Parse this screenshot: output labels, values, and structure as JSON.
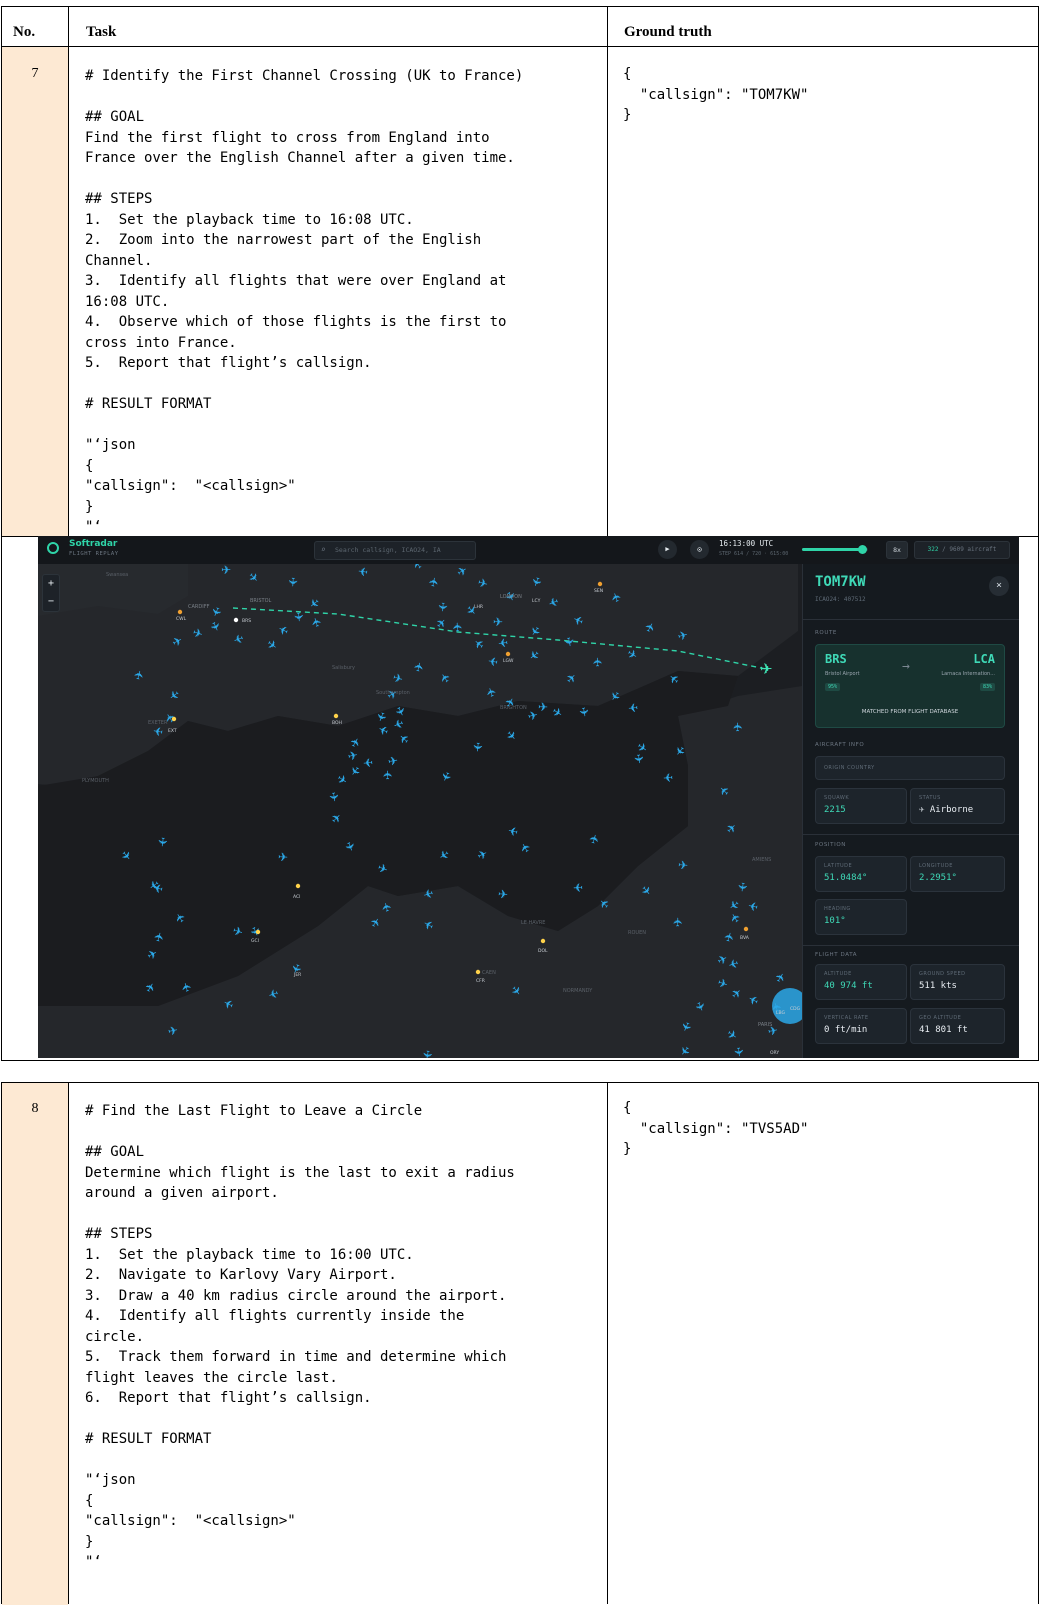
{
  "headers": {
    "no": "No.",
    "task": "Task",
    "ground_truth": "Ground truth"
  },
  "rows": [
    {
      "no": "7",
      "task": "# Identify the First Channel Crossing (UK to France)\n\n## GOAL\nFind the first flight to cross from England into\nFrance over the English Channel after a given time.\n\n## STEPS\n1.  Set the playback time to 16:08 UTC.\n2.  Zoom into the narrowest part of the English\nChannel.\n3.  Identify all flights that were over England at\n16:08 UTC.\n4.  Observe which of those flights is the first to\ncross into France.\n5.  Report that flight’s callsign.\n\n# RESULT FORMAT\n\n\"‘json\n{\n\"callsign\":  \"<callsign>\"\n}\n\"‘",
      "ground_truth": "{\n  \"callsign\": \"TOM7KW\"\n}"
    },
    {
      "no": "8",
      "task": "# Find the Last Flight to Leave a Circle\n\n## GOAL\nDetermine which flight is the last to exit a radius\naround a given airport.\n\n## STEPS\n1.  Set the playback time to 16:00 UTC.\n2.  Navigate to Karlovy Vary Airport.\n3.  Draw a 40 km radius circle around the airport.\n4.  Identify all flights currently inside the\ncircle.\n5.  Track them forward in time and determine which\nflight leaves the circle last.\n6.  Report that flight’s callsign.\n\n# RESULT FORMAT\n\n\"‘json\n{\n\"callsign\":  \"<callsign>\"\n}\n\"‘",
      "ground_truth": "{\n  \"callsign\": \"TVS5AD\"\n}"
    }
  ],
  "screenshot": {
    "app_name": "Softradar",
    "app_subtitle": "FLIGHT REPLAY",
    "search_placeholder": "Search callsign, ICAO24, IA",
    "time": "16:13:00 UTC",
    "step": "STEP 614 / 720 · 615:00",
    "speed": "8x",
    "aircraft_count": "322",
    "aircraft_total": "/ 9609 aircraft",
    "zoom_in": "+",
    "zoom_out": "−",
    "map_labels": {
      "cardiff": "CARDIFF",
      "bristol": "BRISTOL",
      "cwl": "CWL",
      "brs": "BRS",
      "swansea": "Swansea",
      "london": "LONDON",
      "lhr": "LHR",
      "lgw": "LGW",
      "lcy": "LCY",
      "sen": "SEN",
      "salisbury": "Salisbury",
      "southampton": "Southampton",
      "boh": "BOH",
      "brighton": "BRIGHTON",
      "exeter": "EXETER",
      "ext": "EXT",
      "plymouth": "PLYMOUTH",
      "amiens": "AMIENS",
      "aci": "ACI",
      "gci": "GCI",
      "jer": "JER",
      "le_havre": "LE HAVRE",
      "dol": "DOL",
      "rouen": "ROUEN",
      "bva": "BVA",
      "caen": "CAEN",
      "cfr": "CFR",
      "normandy": "NORMANDY",
      "paris": "PARIS",
      "lbg": "LBG",
      "cdg": "CDG",
      "ory": "ORY"
    },
    "panel": {
      "callsign": "TOM7KW",
      "icao": "ICAO24: 407512",
      "close": "×",
      "route_label": "ROUTE",
      "from_code": "BRS",
      "from_name": "Bristol Airport",
      "from_pct": "95%",
      "to_code": "LCA",
      "to_name": "Larnaca Internation...",
      "to_pct": "83%",
      "arrow": "→",
      "matched": "MATCHED FROM FLIGHT DATABASE",
      "aircraft_info_label": "AIRCRAFT INFO",
      "origin_country": "ORIGIN COUNTRY",
      "squawk_label": "SQUAWK",
      "squawk": "2215",
      "status_label": "STATUS",
      "status": "Airborne",
      "position_label": "POSITION",
      "lat_label": "LATITUDE",
      "lat": "51.0484°",
      "lon_label": "LONGITUDE",
      "lon": "2.2951°",
      "heading_label": "HEADING",
      "heading": "101°",
      "flight_data_label": "FLIGHT DATA",
      "alt_label": "ALTITUDE",
      "alt": "40 974 ft",
      "gs_label": "GROUND SPEED",
      "gs": "511 kts",
      "vr_label": "VERTICAL RATE",
      "vr": "0 ft/min",
      "geo_label": "GEO ALTITUDE",
      "geo": "41 801 ft"
    }
  }
}
